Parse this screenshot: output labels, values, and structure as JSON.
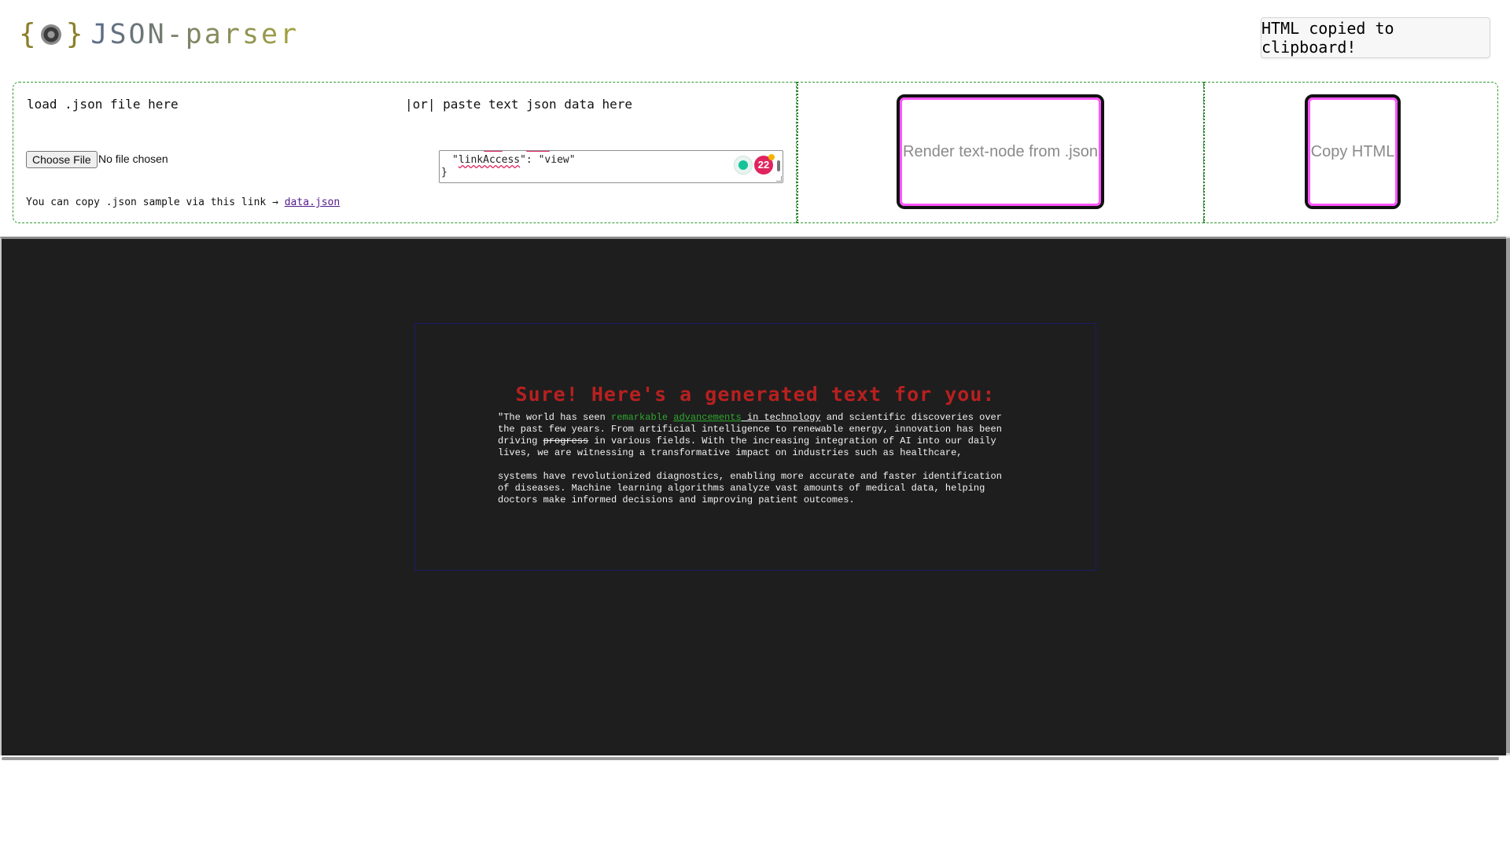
{
  "header": {
    "logo_brace_open": "{",
    "logo_brace_close": "}",
    "logo_text": "JSON-parser",
    "toast": "HTML copied to clipboard!"
  },
  "load_panel": {
    "load_label": "load .json file here",
    "paste_label": "|or| paste text json data here",
    "file_button": "Choose File",
    "file_status": "No file chosen",
    "sample_prefix": "You can copy .json sample via this link → ",
    "sample_link": "data.json",
    "json_line1_pre": "\"",
    "json_line1_key": "linkAccess",
    "json_line1_post": "\": \"view\"",
    "json_line2": "}",
    "issue_count": "22"
  },
  "buttons": {
    "render": "Render text-node from .json",
    "copy": "Copy HTML"
  },
  "preview": {
    "heading": "Sure! Here's a generated text for you:",
    "p1_a": "\"The world has seen ",
    "p1_b": "remarkable",
    "p1_c": " ",
    "p1_d": "advancements",
    "p1_e": " in technology",
    "p1_f": " and scientific discoveries over the past few years. From artificial intelligence to renewable energy, innovation has been driving ",
    "p1_g": "progress",
    "p1_h": " in various fields. With the increasing integration of AI into our daily lives, we are witnessing a transformative impact on industries such as healthcare,",
    "p2": "systems have revolutionized diagnostics, enabling more accurate and faster identification of diseases. Machine learning algorithms analyze vast amounts of medical data, helping doctors make informed decisions and improving patient outcomes."
  },
  "colors": {
    "panel_border": "#2e9a2e",
    "button_border": "#ff55ff",
    "heading": "#b82020",
    "highlight_green": "#2ea82e",
    "preview_bg": "#1e1e1e"
  },
  "icons": [
    "eye-logo-icon",
    "grammarly-icon",
    "issue-count-badge"
  ]
}
